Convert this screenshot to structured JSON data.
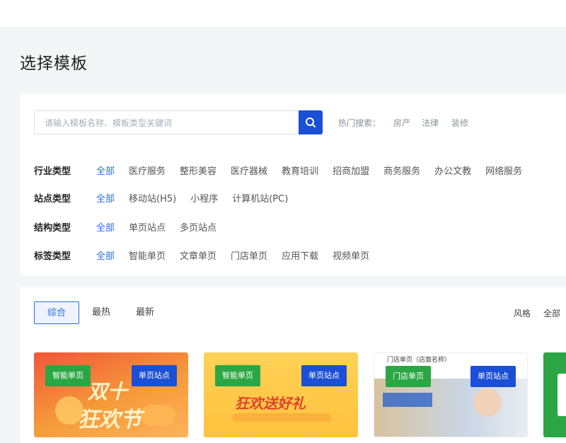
{
  "page": {
    "title": "选择模板"
  },
  "search": {
    "placeholder": "请输入模板名称、模板类型关键词"
  },
  "hot_search": {
    "label": "热门搜索：",
    "terms": [
      "房产",
      "法律",
      "装修"
    ]
  },
  "filters": [
    {
      "label": "行业类型",
      "options": [
        "全部",
        "医疗服务",
        "整形美容",
        "医疗器械",
        "教育培训",
        "招商加盟",
        "商务服务",
        "办公文教",
        "网络服务"
      ]
    },
    {
      "label": "站点类型",
      "options": [
        "全部",
        "移动站(H5)",
        "小程序",
        "计算机站(PC)"
      ]
    },
    {
      "label": "结构类型",
      "options": [
        "全部",
        "单页站点",
        "多页站点"
      ]
    },
    {
      "label": "标签类型",
      "options": [
        "全部",
        "智能单页",
        "文章单页",
        "门店单页",
        "应用下载",
        "视频单页"
      ]
    }
  ],
  "sort_tabs": [
    "综合",
    "最热",
    "最新"
  ],
  "right_filters": [
    "风格",
    "全部"
  ],
  "cards": [
    {
      "badge_left": "智能单页",
      "badge_right": "单页站点",
      "banner_line1": "双十",
      "banner_line2": "狂欢节"
    },
    {
      "badge_left": "智能单页",
      "badge_right": "单页站点",
      "banner_line1": "狂欢送好礼",
      "banner_line2": ""
    },
    {
      "badge_left": "门店单页",
      "badge_right": "单页站点",
      "banner_line1": "门店单页（店面名称）",
      "banner_line2": ""
    }
  ],
  "colors": {
    "accent": "#2d6be4",
    "primary_button": "#1a4fd6",
    "badge_green": "#2aa744"
  }
}
